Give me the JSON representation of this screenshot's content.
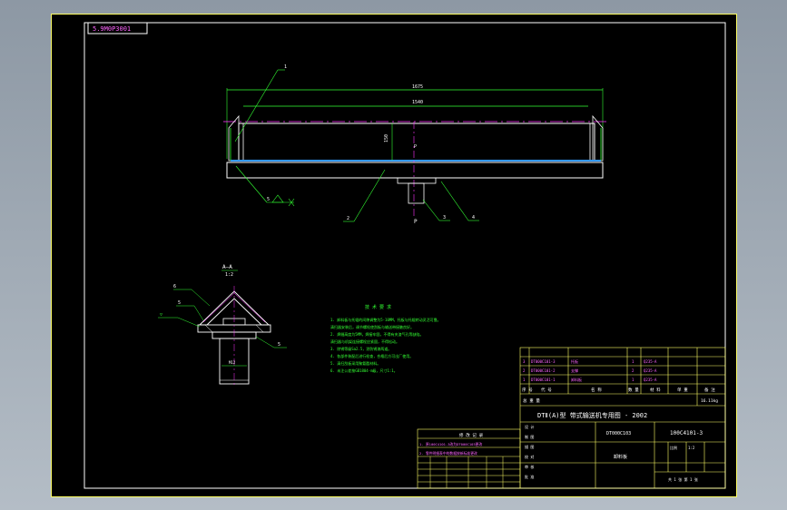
{
  "drawing": {
    "frame_label": "5.9M0P3001",
    "dim_overall": "1675",
    "dim_inner": "1540",
    "dim_height": "150",
    "view_label": "P",
    "section_label": "A—A",
    "section_scale": "1:2",
    "callouts": [
      "1",
      "2",
      "3",
      "4",
      "5",
      "6"
    ],
    "dim_shaft": "M12",
    "weld_note": "▽"
  },
  "notes": {
    "title": "技 术 要 求",
    "lines": [
      "1. 卸料板与托辊的间隙调整为5-10MM，托板与托辊转动灵活可靠。",
      "   清扫器安装后，调节螺栓使刮板与输送带接触良好。",
      "2. 焊缝高度为5MM，焊接牢固，不得有夹渣气孔等缺陷。",
      "   清扫器与机架连接螺栓应紧固，不得松动。",
      "3. 除锈等级Sa2.5，涂防锈漆两道。",
      "4. 各部件装配后进行检查，合格后方可出厂使用。",
      "5. 清扫刮板采用聚氨酯材料。",
      "6. 未注公差按GB1804-m级，尺寸1:1。"
    ]
  },
  "titleblock": {
    "company": "DTⅡ(A)型 带式输送机专用图 - 2002",
    "drawing_no": "100C4101-3",
    "part_name": "卸料板",
    "code": "DT000C103",
    "total_weight_label": "总 重 量",
    "total_weight": "16.11kg",
    "header_cols": [
      "序 号",
      "代 号",
      "名 称",
      "数 量",
      "材 料",
      "单 重",
      "备 注"
    ],
    "bom_rows": [
      [
        "3",
        "DT000C101-3",
        "托板",
        "1",
        "Q235-A",
        "",
        ""
      ],
      [
        "2",
        "DT000C101-2",
        "支撑",
        "2",
        "Q235-A",
        "",
        ""
      ],
      [
        "1",
        "DT000C101-1",
        "卸料板",
        "1",
        "Q235-A",
        "",
        ""
      ]
    ],
    "sign_rows": [
      "设 计",
      "制 图",
      "描 图",
      "校 对",
      "审 核",
      "批 准"
    ],
    "scale_label": "比例",
    "scale": "1:2",
    "sheet_label": "共 1 张  第 1 张"
  },
  "revisions": {
    "title": "修 改 记 录",
    "lines": [
      "1. 原100C4101-3改为DT000C103更改",
      "2. 零件明细表中的数据按新标准更改"
    ]
  }
}
